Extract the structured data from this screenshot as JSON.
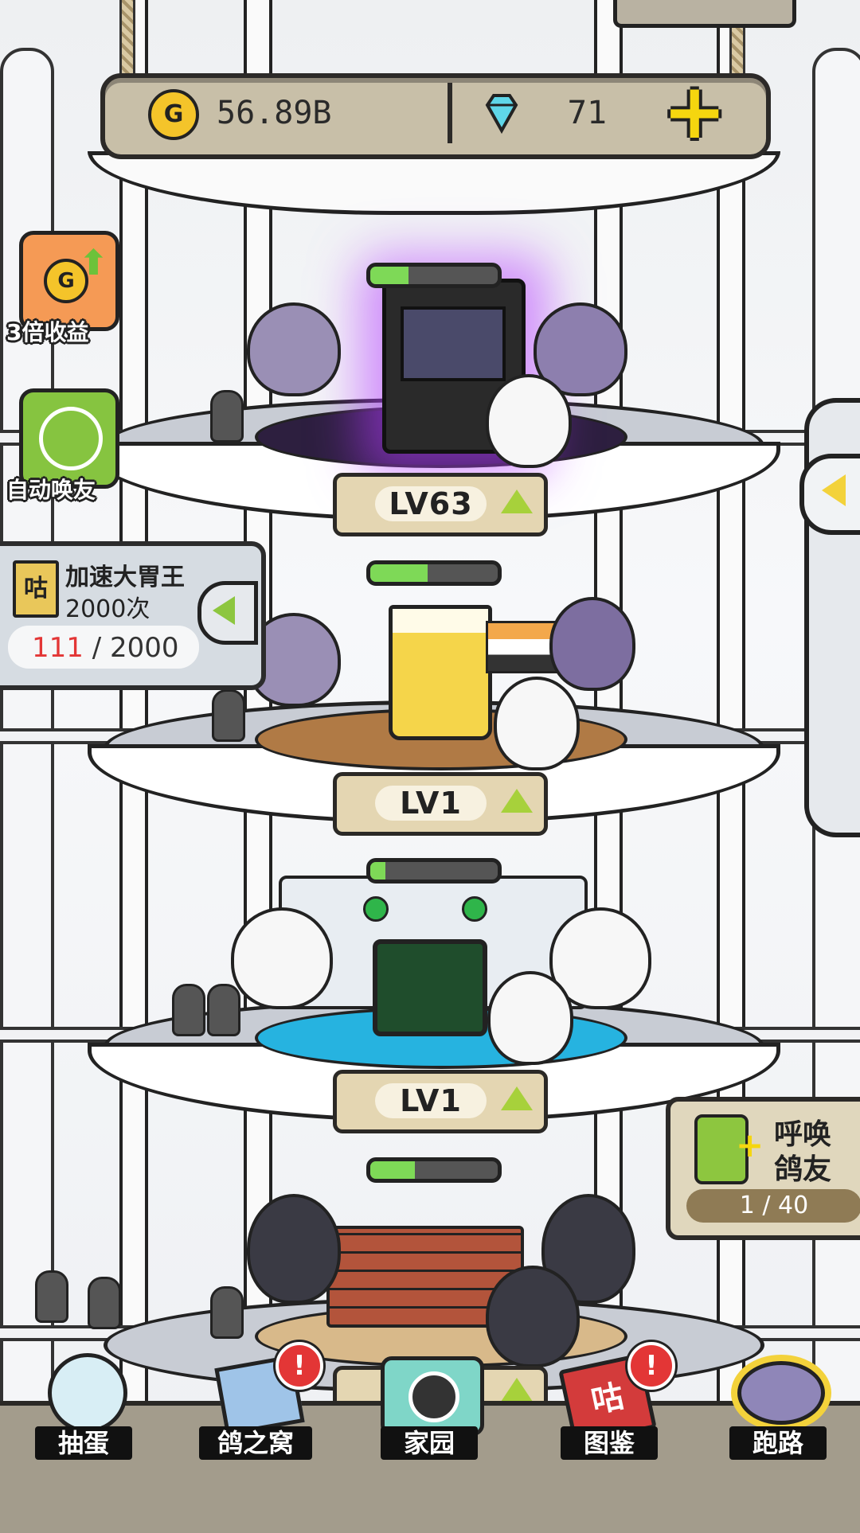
{
  "currency": {
    "gold_icon": "G",
    "gold": "56.89B",
    "gem_icon": "diamond-icon",
    "gems": "71",
    "add_icon": "plus-icon"
  },
  "side_buttons": {
    "triple_income": "3倍收益",
    "auto_summon": "自动唤友"
  },
  "task": {
    "icon_char": "咕",
    "title_line1": "加速大胃王",
    "title_line2": "2000次",
    "progress_current": "111",
    "progress_sep": " / ",
    "progress_total": "2000"
  },
  "floors": [
    {
      "level": "LV63",
      "progress": 0.3,
      "theme": "arcade"
    },
    {
      "level": "LV1",
      "progress": 0.45,
      "theme": "bar"
    },
    {
      "level": "LV1",
      "progress": 0.12,
      "theme": "hospital"
    },
    {
      "level": "",
      "progress": 0.35,
      "theme": "construction"
    }
  ],
  "summon": {
    "label_line1": "呼唤",
    "label_line2": "鸽友",
    "count": "1 / 40"
  },
  "nav": [
    {
      "label": "抽蛋",
      "icon": "gacha-icon",
      "badge": ""
    },
    {
      "label": "鸽之窝",
      "icon": "nest-icon",
      "badge": "!"
    },
    {
      "label": "家园",
      "icon": "camera-icon",
      "badge": ""
    },
    {
      "label": "图鉴",
      "icon": "book-icon",
      "badge": "!",
      "book_char": "咕"
    },
    {
      "label": "跑路",
      "icon": "run-icon",
      "badge": ""
    }
  ],
  "colors": {
    "gold": "#f4c42a",
    "gem": "#5fd6e8",
    "accent_green": "#a7d13b",
    "task_red": "#e33636"
  }
}
